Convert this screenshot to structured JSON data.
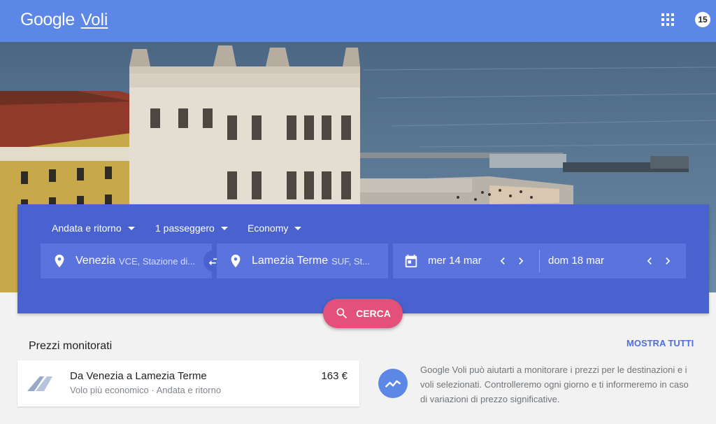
{
  "header": {
    "logo_google": "Google",
    "logo_voli": "Voli",
    "avatar_text": "15",
    "color": "#5c87e6"
  },
  "search": {
    "trip_type": "Andata e ritorno",
    "passengers": "1 passeggero",
    "cabin_class": "Economy",
    "origin_city": "Venezia",
    "origin_detail": "VCE, Stazione di...",
    "destination_city": "Lamezia Terme",
    "destination_detail": "SUF, St...",
    "depart_date": "mer 14 mar",
    "return_date": "dom 18 mar",
    "search_label": "CERCA",
    "panel_color": "#4a62cf",
    "button_color": "#e35079"
  },
  "tracked": {
    "title": "Prezzi monitorati",
    "show_all": "MOSTRA TUTTI",
    "card": {
      "route": "Da Venezia a Lamezia Terme",
      "subtitle": "Volo più economico · Andata e ritorno",
      "price": "163 €"
    },
    "info": "Google Voli può aiutarti a monitorare i prezzi per le destinazioni e i voli selezionati. Controlleremo ogni giorno e ti informeremo in caso di variazioni di prezzo significative."
  },
  "icons": [
    "apps-grid-icon",
    "location-pin-icon",
    "swap-icon",
    "calendar-icon",
    "chevron-left-icon",
    "chevron-right-icon",
    "search-icon",
    "airline-logo-icon",
    "trending-icon"
  ]
}
